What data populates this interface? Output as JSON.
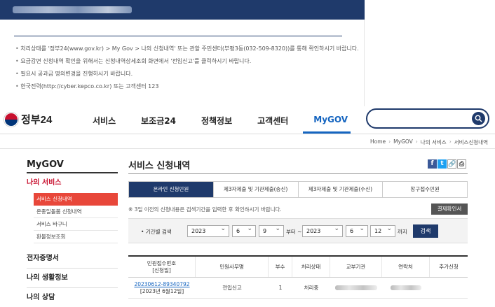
{
  "notice": {
    "items": [
      "처리상태를 '정부24(www.gov.kr) > My Gov > 나의 신청내역' 또는 관할 주민센터(부평3동(032-509-8320))를 통해 확인하시기 바랍니다.",
      "요금감면 신청내역 확인을 위해서는 신청내역상세조회 화면에서 '전입신고'를 클릭하시기 바랍니다.",
      "필요시 공과금 명의변경을 진행하시기 바랍니다.",
      "한국전력(http://cyber.kepco.co.kr) 또는 고객센터 123"
    ]
  },
  "header": {
    "logo_text": "정부24",
    "menu": [
      "서비스",
      "보조금24",
      "정책정보",
      "고객센터",
      "MyGOV"
    ],
    "search_placeholder": ""
  },
  "breadcrumb": [
    "Home",
    "MyGOV",
    "나의 서비스",
    "서비스신청내역"
  ],
  "lnb": {
    "title": "MyGOV",
    "groups": [
      {
        "label": "나의 서비스"
      },
      {
        "label": "전자증명서"
      },
      {
        "label": "나의 생활정보"
      },
      {
        "label": "나의 상담"
      }
    ],
    "subs": [
      "서비스 신청내역",
      "온종일돌봄 신청내역",
      "서비스 바구니",
      "환불정보조회"
    ]
  },
  "content": {
    "title": "서비스 신청내역",
    "share": {
      "facebook": "f",
      "twitter": "t",
      "link": "🔗",
      "print": "⎙"
    },
    "tabs": [
      "온라인 신청민원",
      "제3자제출 및 기관제출(송신)",
      "제3자제출 및 기관제출(수신)",
      "창구접수민원"
    ],
    "hint": "※ 3일 이전의 신청내용은 검색기간을 입력한 후 확인하시기 바랍니다.",
    "pay_button": "결제확인서",
    "search": {
      "label": "• 기간별 검색",
      "from_year": "2023",
      "from_month": "6",
      "from_day": "9",
      "from_text": "부터 ~",
      "to_year": "2023",
      "to_month": "6",
      "to_day": "12",
      "to_text": "까지",
      "button": "검색"
    },
    "table": {
      "headers": [
        [
          "민원접수번호",
          "[신청일]"
        ],
        [
          "민원사무명"
        ],
        [
          "부수"
        ],
        [
          "처리상태"
        ],
        [
          "교부기관"
        ],
        [
          "연락처"
        ],
        [
          "추가신청"
        ]
      ],
      "rows": [
        {
          "no": "20230612-89340792",
          "date": "[2023년 6월12일]",
          "name": "전입신고",
          "count": "1",
          "status": "처리중"
        }
      ]
    }
  }
}
